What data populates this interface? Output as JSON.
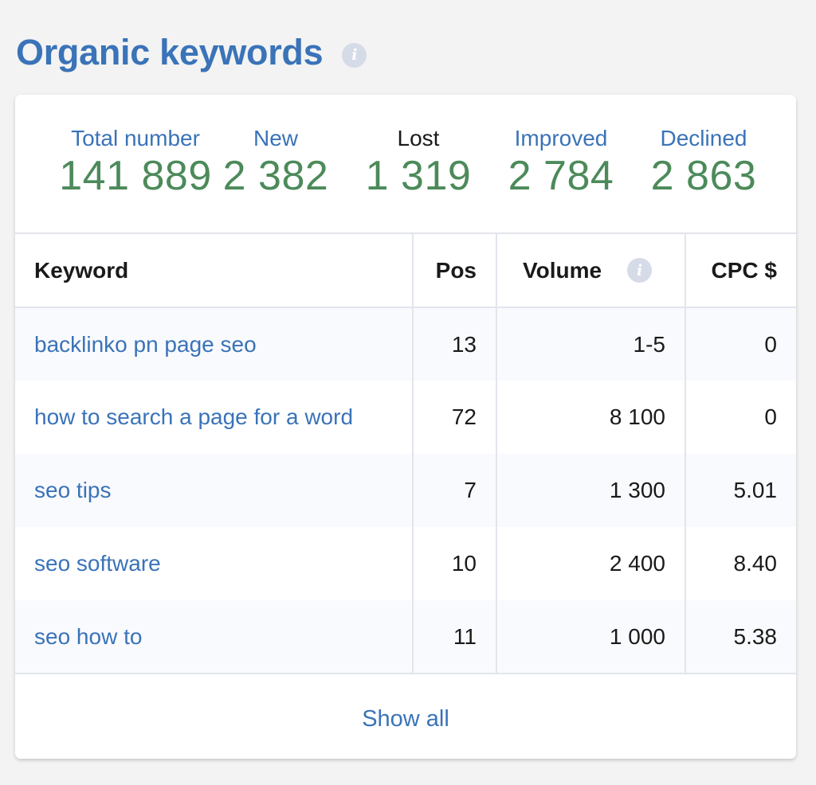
{
  "header": {
    "title": "Organic keywords",
    "info_icon": "info-icon"
  },
  "summary": {
    "total_label": "Total number",
    "total_value": "141 889",
    "new_label": "New",
    "new_value": "2 382",
    "lost_label": "Lost",
    "lost_value": "1 319",
    "improved_label": "Improved",
    "improved_value": "2 784",
    "declined_label": "Declined",
    "declined_value": "2 863"
  },
  "table": {
    "headers": {
      "keyword": "Keyword",
      "pos": "Pos",
      "volume": "Volume",
      "cpc": "CPC $"
    },
    "rows": [
      {
        "keyword": "backlinko pn page seo",
        "pos": "13",
        "volume": "1-5",
        "cpc": "0"
      },
      {
        "keyword": "how to search a page for a word",
        "pos": "72",
        "volume": "8 100",
        "cpc": "0"
      },
      {
        "keyword": "seo tips",
        "pos": "7",
        "volume": "1 300",
        "cpc": "5.01"
      },
      {
        "keyword": "seo software",
        "pos": "10",
        "volume": "2 400",
        "cpc": "8.40"
      },
      {
        "keyword": "seo how to",
        "pos": "11",
        "volume": "1 000",
        "cpc": "5.38"
      }
    ]
  },
  "footer": {
    "show_all_label": "Show all"
  },
  "colors": {
    "accent_blue": "#3a73b8",
    "value_green": "#4c8a5a",
    "info_icon_gray": "#d6dbe8"
  }
}
